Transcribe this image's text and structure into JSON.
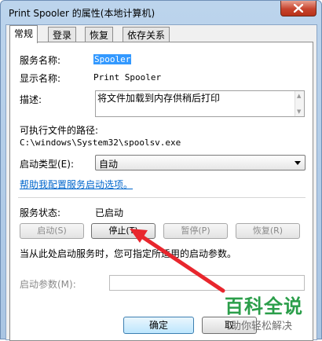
{
  "window": {
    "title": "Print Spooler 的属性(本地计算机)"
  },
  "tabs": [
    {
      "label": "常规",
      "active": true
    },
    {
      "label": "登录",
      "active": false
    },
    {
      "label": "恢复",
      "active": false
    },
    {
      "label": "依存关系",
      "active": false
    }
  ],
  "general": {
    "service_name_label": "服务名称:",
    "service_name_value": "Spooler",
    "display_name_label": "显示名称:",
    "display_name_value": "Print Spooler",
    "description_label": "描述:",
    "description_value": "将文件加载到内存供稍后打印",
    "exe_path_label": "可执行文件的路径:",
    "exe_path_value": "C:\\windows\\System32\\spoolsv.exe",
    "startup_type_label": "启动类型(E):",
    "startup_type_value": "自动",
    "help_link": "帮助我配置服务启动选项。",
    "status_label": "服务状态:",
    "status_value": "已启动",
    "start_button": "启动(S)",
    "stop_button": "停止(T)",
    "pause_button": "暂停(P)",
    "resume_button": "恢复(R)",
    "hint_text": "当从此处启动服务时，您可指定所适用的启动参数。",
    "start_params_label": "启动参数(M):",
    "start_params_value": ""
  },
  "footer": {
    "ok_button": "确定",
    "cancel_button": "取"
  },
  "watermark": {
    "brand": "百科全说",
    "tagline": "助你轻松解决"
  },
  "colors": {
    "selection": "#3399ff",
    "link": "#0066cc",
    "annotation_arrow": "#e8262d",
    "watermark_green": "#2b9e4a"
  }
}
